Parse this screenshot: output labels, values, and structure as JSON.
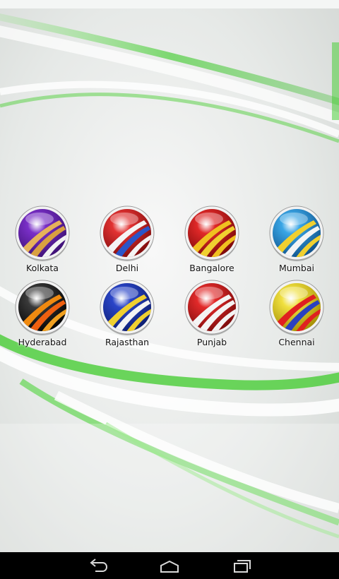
{
  "apps": [
    {
      "label": "Kolkata",
      "icon": "road-logo-purple-icon",
      "color": "#7a2fc8",
      "dark": "#3a0f70",
      "stripes": [
        "#e6b25a",
        "#d9a040",
        "#f2f2f2"
      ]
    },
    {
      "label": "Delhi",
      "icon": "road-logo-red-icon",
      "color": "#e23232",
      "dark": "#7a0a0a",
      "stripes": [
        "#f4f4f4",
        "#2a55c8",
        "#f4f4f4"
      ]
    },
    {
      "label": "Bangalore",
      "icon": "road-logo-red-icon",
      "color": "#e02828",
      "dark": "#760808",
      "stripes": [
        "#f0c020",
        "#f0d030",
        "#f0c020"
      ]
    },
    {
      "label": "Mumbai",
      "icon": "road-logo-blue-icon",
      "color": "#3aa6e6",
      "dark": "#0d4d86",
      "stripes": [
        "#f0d030",
        "#f4f4f4",
        "#f0d030"
      ]
    },
    {
      "label": "Hyderabad",
      "icon": "road-logo-black-icon",
      "color": "#3a3a3a",
      "dark": "#000000",
      "stripes": [
        "#f08a10",
        "#f06010",
        "#f0a020"
      ]
    },
    {
      "label": "Rajasthan",
      "icon": "road-logo-blue-icon",
      "color": "#2a45c8",
      "dark": "#0c1c6c",
      "stripes": [
        "#f0d030",
        "#f4f4f4",
        "#f0d030"
      ]
    },
    {
      "label": "Punjab",
      "icon": "road-logo-red-icon",
      "color": "#e22a2a",
      "dark": "#760a0a",
      "stripes": [
        "#f4f4f4",
        "#f4f4f4",
        "#f4f4f4"
      ]
    },
    {
      "label": "Chennai",
      "icon": "road-logo-yellow-icon",
      "color": "#f0e040",
      "dark": "#a08a00",
      "stripes": [
        "#e02020",
        "#2a40c0",
        "#e02020"
      ]
    }
  ],
  "nav": {
    "back_icon": "back-icon",
    "home_icon": "home-icon",
    "recents_icon": "recents-icon"
  },
  "colors": {
    "nav_background": "#000000",
    "nav_icon": "#d8d8d8",
    "wallpaper_green": "#3dcb2a"
  }
}
